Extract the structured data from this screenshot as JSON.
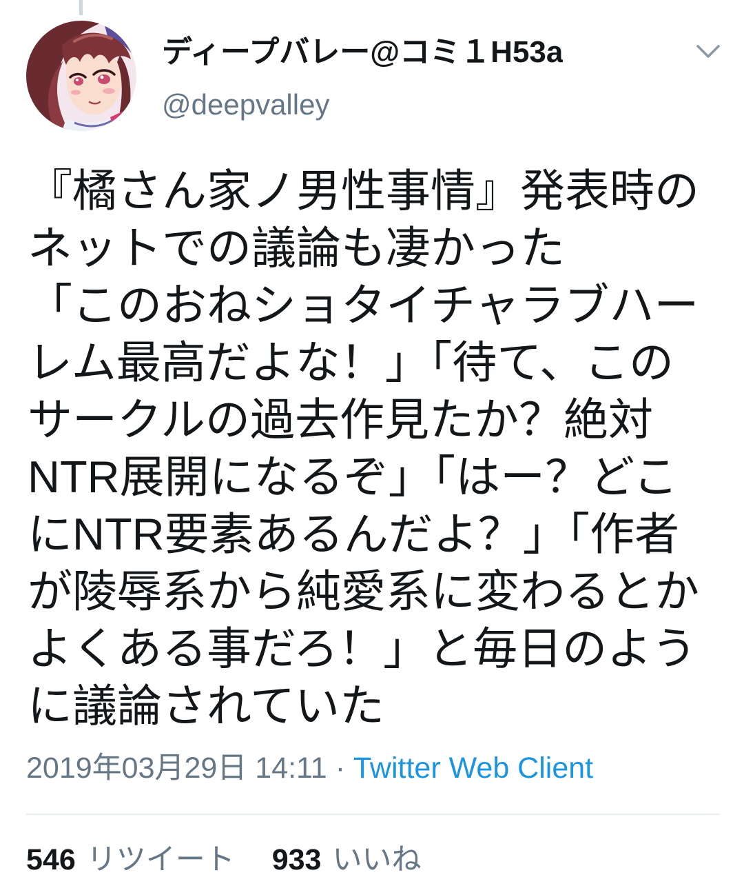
{
  "author": {
    "display_name": "ディープバレー@コミ１H53a",
    "username": "@deepvalley"
  },
  "menu": {
    "icon": "chevron-down-icon"
  },
  "tweet": {
    "text_lines": [
      "『橘さん家ノ男性事情』発表時の",
      "ネットでの議論も凄かった",
      "「このおねショタイチャラブハー",
      "レム最高だよな！」「待て、この",
      "サークルの過去作見たか？絶対",
      "NTR展開になるぞ」「はー？どこ",
      "にNTR要素あるんだよ？」「作者",
      "が陵辱系から純愛系に変わるとか",
      "よくある事だろ！」と毎日のよう",
      "に議論されていた"
    ],
    "timestamp": "2019年03月29日 14:11",
    "separator": "·",
    "source": "Twitter Web Client"
  },
  "stats": {
    "retweets": {
      "count": "546",
      "label": "リツイート"
    },
    "likes": {
      "count": "933",
      "label": "いいね"
    }
  },
  "colors": {
    "text": "#14171a",
    "secondary": "#657786",
    "link": "#1b95e0",
    "divider": "#e6ecf0",
    "icon": "#8899a6",
    "thread": "#ccd6dd",
    "bg": "#ffffff"
  }
}
